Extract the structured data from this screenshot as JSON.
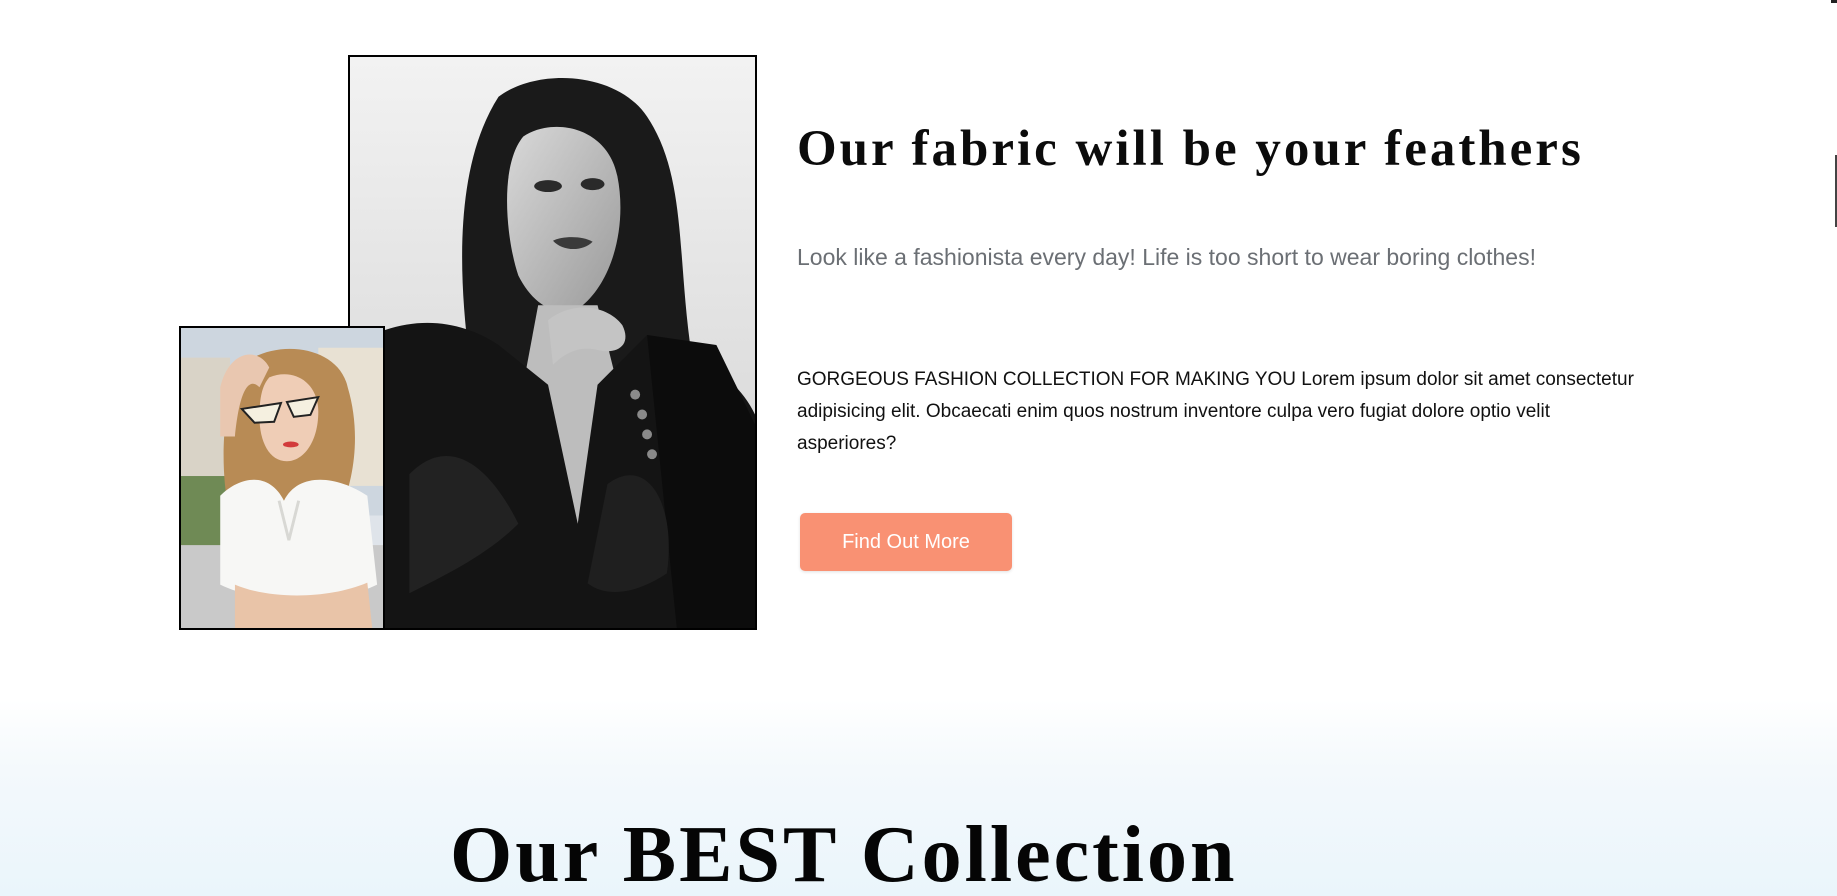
{
  "hero": {
    "headline": "Our fabric will be your feathers",
    "subtitle": "Look like a fashionista every day! Life is too short to wear boring clothes!",
    "body": "GORGEOUS FASHION COLLECTION FOR MAKING YOU Lorem ipsum dolor sit amet consectetur adipisicing elit. Obcaecati enim quos nostrum inventore culpa vero fugiat dolore optio velit asperiores?",
    "cta_label": "Find Out More"
  },
  "collection": {
    "title": "Our BEST Collection"
  },
  "colors": {
    "accent": "#f99173",
    "headline": "#0b0b0b",
    "subtitle": "#6b6f74",
    "band": "#eaf5fb"
  }
}
